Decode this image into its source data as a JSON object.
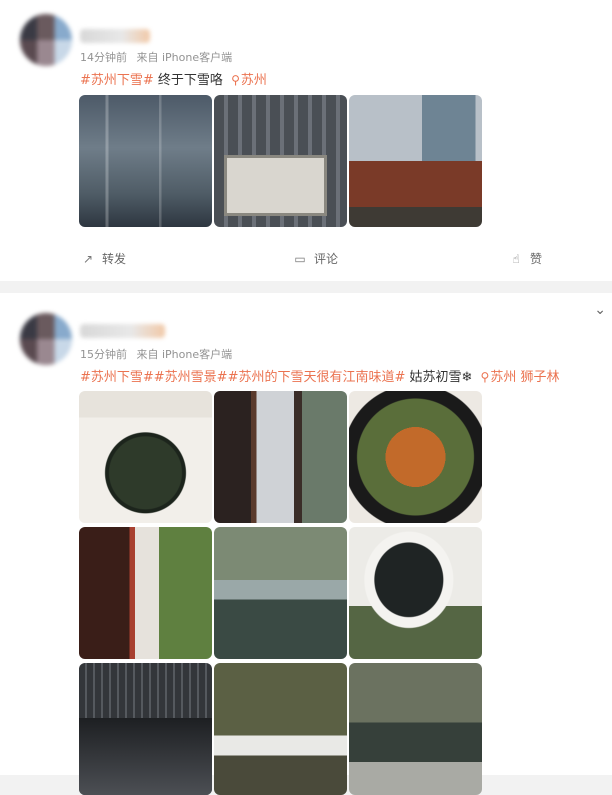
{
  "posts": [
    {
      "meta": {
        "time": "14分钟前",
        "source": "来自 iPhone客户端"
      },
      "tags": "#苏州下雪#",
      "text": " 终于下雪咯",
      "location": "苏州",
      "actions": {
        "repost": "转发",
        "comment": "评论",
        "like": "赞"
      }
    },
    {
      "meta": {
        "time": "15分钟前",
        "source": "来自 iPhone客户端"
      },
      "tags": "#苏州下雪##苏州雪景##苏州的下雪天很有江南味道#",
      "text": " 姑苏初雪❄",
      "location": "苏州 狮子林"
    }
  ],
  "icons": {
    "repost": "repost-icon",
    "comment": "comment-icon",
    "like": "like-icon",
    "location": "location-pin-icon",
    "menu": "chevron-down-icon"
  },
  "colors": {
    "accent": "#eb7350",
    "meta": "#939393",
    "background": "#f2f2f2"
  }
}
